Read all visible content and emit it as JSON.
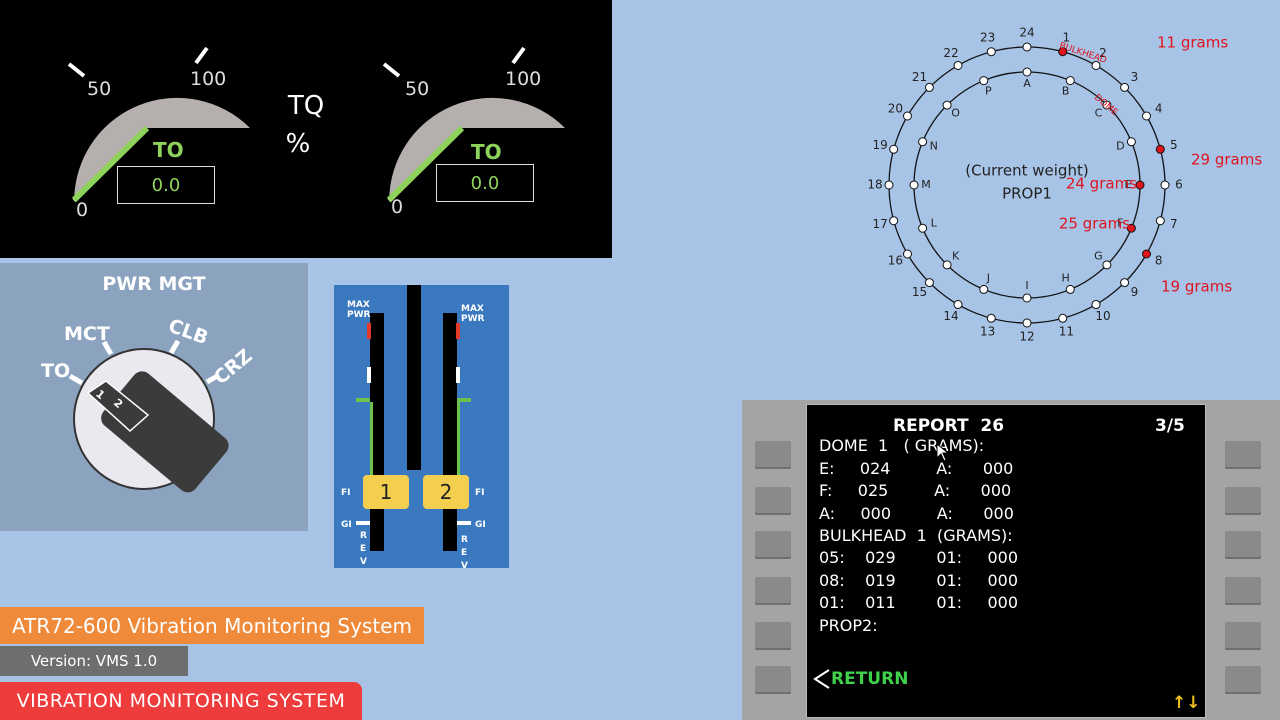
{
  "tq": {
    "title": "TQ",
    "unit": "%",
    "gauges": [
      {
        "tick_0": "0",
        "tick_50": "50",
        "tick_100": "100",
        "to_label": "TO",
        "value": "0.0",
        "level_percent": 0
      },
      {
        "tick_0": "0",
        "tick_50": "50",
        "tick_100": "100",
        "to_label": "TO",
        "value": "0.0",
        "level_percent": 0
      }
    ]
  },
  "pwr_mgt": {
    "title": "PWR MGT",
    "positions": [
      "TO",
      "MCT",
      "CLB",
      "CRZ"
    ],
    "selected": "TO",
    "knob_marks": [
      "1",
      "2"
    ]
  },
  "levers": {
    "left_label": "MAX PWR",
    "right_label": "MAX PWR",
    "lever1": "1",
    "lever2": "2",
    "fi": "FI",
    "gi": "GI",
    "rev": [
      "R",
      "E",
      "V"
    ]
  },
  "balance": {
    "center_line1": "(Current weight)",
    "center_line2": "PROP1",
    "outer_label": "BULKHEAD",
    "inner_label": "DOME",
    "outer_numbers": [
      "1",
      "2",
      "3",
      "4",
      "5",
      "6",
      "7",
      "8",
      "9",
      "10",
      "11",
      "12",
      "13",
      "14",
      "15",
      "16",
      "17",
      "18",
      "19",
      "20",
      "21",
      "22",
      "23",
      "24"
    ],
    "inner_letters": [
      "A",
      "B",
      "C",
      "D",
      "E",
      "F",
      "G",
      "H",
      "I",
      "J",
      "K",
      "L",
      "M",
      "N",
      "O",
      "P"
    ],
    "weights": [
      {
        "position": "1",
        "text": "11 grams"
      },
      {
        "position": "5",
        "text": "29 grams"
      },
      {
        "position": "E",
        "text": "24 grams"
      },
      {
        "position": "F",
        "text": "25 grams"
      },
      {
        "position": "8",
        "text": "19 grams"
      }
    ],
    "marker_color": "#e0141e"
  },
  "mcdu": {
    "title": "REPORT  26",
    "page": "3/5",
    "lines": [
      "DOME  1   ( GRAMS):",
      "E:     024         A:      000",
      "F:     025         A:      000",
      "A:     000         A:      000",
      "BULKHEAD  1  (GRAMS):",
      "05:    029        01:     000",
      "08:    019        01:     000",
      "01:    011        01:     000",
      "PROP2:"
    ],
    "return_label": "RETURN",
    "scroll_arrows": "↑↓"
  },
  "footer": {
    "app_title": "ATR72-600 Vibration Monitoring System",
    "version": "Version: VMS 1.0",
    "banner": "VIBRATION MONITORING SYSTEM"
  },
  "colors": {
    "accent_green": "#8ed25b",
    "panel_black": "#000000",
    "orange": "#ee8a3a",
    "red": "#ee3b3b",
    "background": "#a7c4e6"
  }
}
